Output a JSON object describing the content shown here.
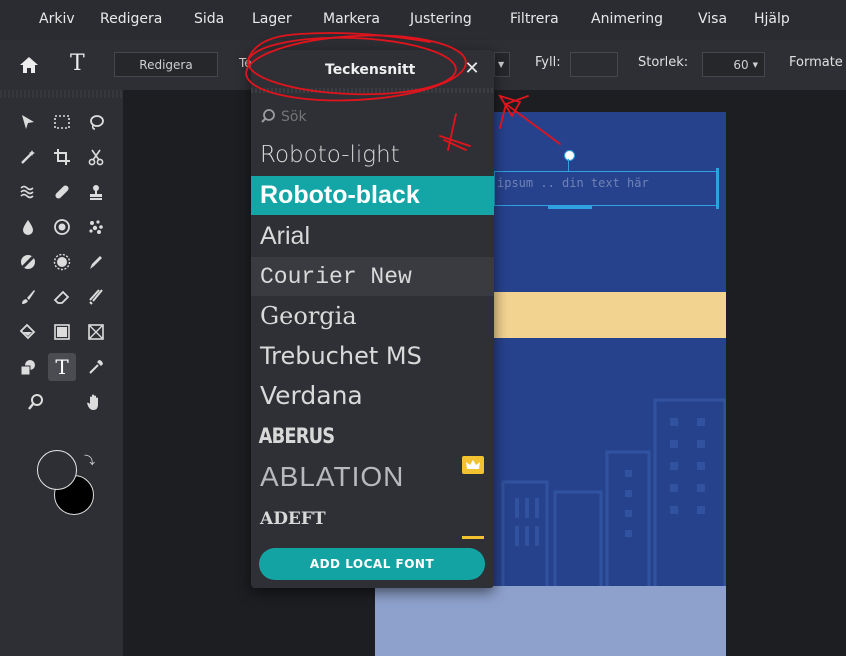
{
  "menu": [
    "Arkiv",
    "Redigera",
    "Sida",
    "Lager",
    "Markera",
    "Justering",
    "Filtrera",
    "Animering",
    "Visa",
    "Hjälp"
  ],
  "options": {
    "edit_label": "Redigera",
    "fill_label": "Fyll:",
    "size_label": "Storlek:",
    "size_value": "60",
    "format_label": "Formate",
    "font_field_partial": "Te"
  },
  "font_panel": {
    "title": "Teckensnitt",
    "search_placeholder": "Sök",
    "fonts": [
      "Roboto-light",
      "Roboto-black",
      "Arial",
      "Courier New",
      "Georgia",
      "Trebuchet MS",
      "Verdana",
      "ABERUS",
      "ABLATION",
      "ADEFT"
    ],
    "selected": "Roboto-black",
    "premium_font": "ABLATION",
    "add_local_font_label": "ADD LOCAL FONT"
  },
  "canvas": {
    "text_layer": "ipsum .. din text här"
  },
  "colors": {
    "accent": "#14a6a6",
    "document_bg": "#27428d",
    "banner": "#f3d390",
    "lower_band": "#8ea1cd",
    "annotation": "#e0141c",
    "crown": "#f2c230"
  }
}
